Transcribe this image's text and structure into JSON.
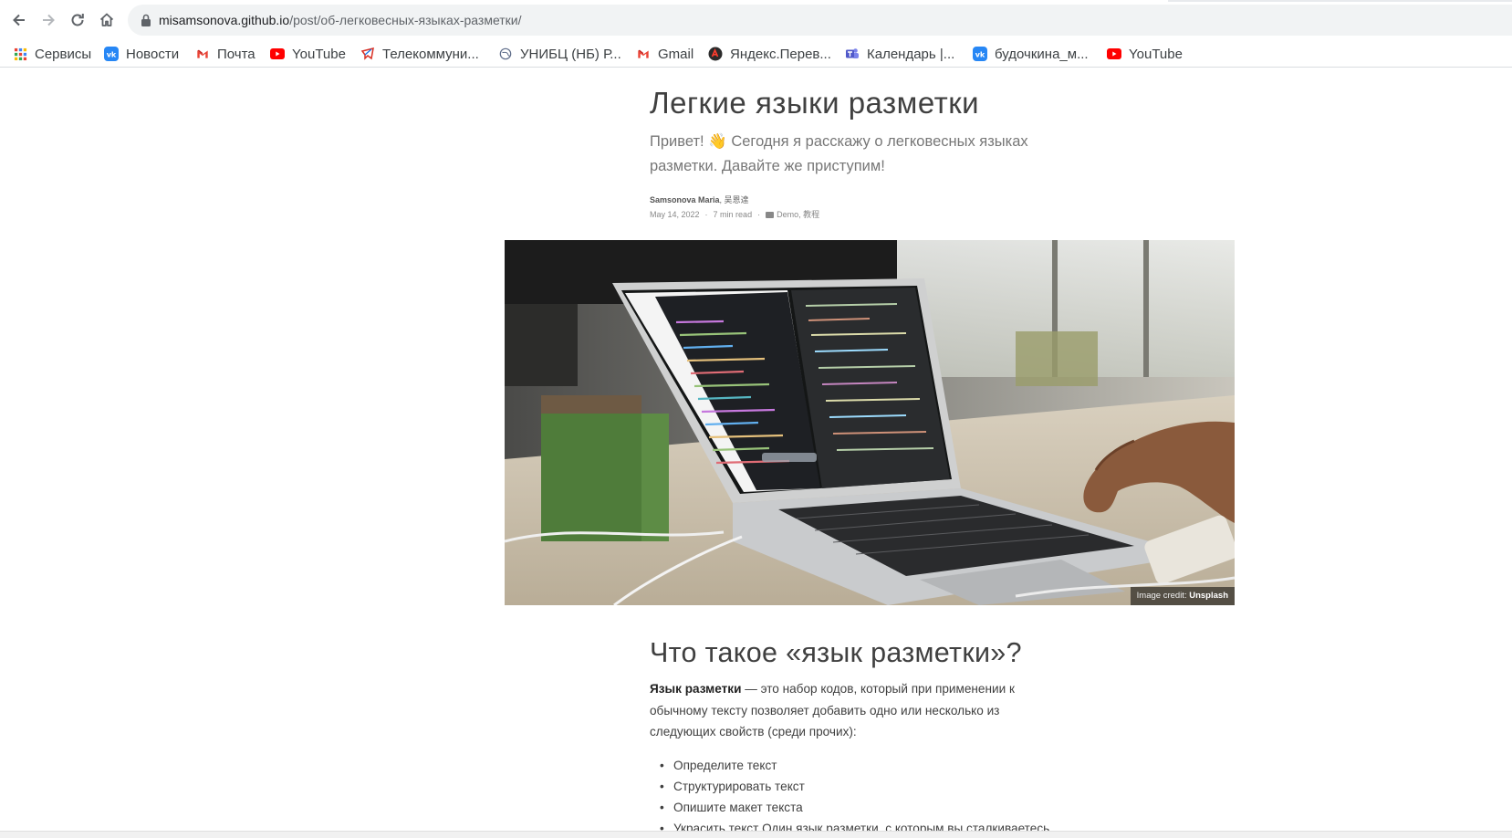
{
  "browser": {
    "url_host": "misamsonova.github.io",
    "url_path": "/post/об-легковесных-языках-разметки/",
    "bookmarks": [
      {
        "label": "Сервисы",
        "icon": "apps-grid-icon"
      },
      {
        "label": "Новости",
        "icon": "vk-icon"
      },
      {
        "label": "Почта",
        "icon": "gmail-icon"
      },
      {
        "label": "YouTube",
        "icon": "youtube-icon"
      },
      {
        "label": "Телекоммуни...",
        "icon": "telecom-icon"
      },
      {
        "label": "УНИБЦ (НБ) Р...",
        "icon": "globe-icon"
      },
      {
        "label": "Gmail",
        "icon": "gmail-icon"
      },
      {
        "label": "Яндекс.Перев...",
        "icon": "yandex-translate-icon"
      },
      {
        "label": "Календарь |...",
        "icon": "teams-icon"
      },
      {
        "label": "будочкина_м...",
        "icon": "vk-icon"
      },
      {
        "label": "YouTube",
        "icon": "youtube-icon"
      }
    ]
  },
  "post": {
    "title": "Легкие языки разметки",
    "subtitle": "Привет! 👋 Сегодня я расскажу о легковесных языках разметки. Давайте же приступим!",
    "author": "Samsonova Maria",
    "author_extra": ", 吴恩達",
    "date": "May 14, 2022",
    "read_time": "7 min read",
    "categories": "Demo, 教程",
    "image_credit_label": "Image credit: ",
    "image_credit_source": "Unsplash"
  },
  "section": {
    "heading": "Что такое «язык разметки»?",
    "intro_bold": "Язык разметки",
    "intro_text": " — это набор кодов, который при применении к обычному тексту позволяет добавить одно или несколько из следующих свойств (среди прочих):",
    "items": [
      "Определите текст",
      "Структурировать текст",
      "Опишите макет текста",
      "Украсить текст Один язык разметки, с которым вы сталкиваетесь"
    ]
  },
  "colors": {
    "text": "#404040",
    "muted": "#777777",
    "omnibox": "#f1f3f4"
  }
}
